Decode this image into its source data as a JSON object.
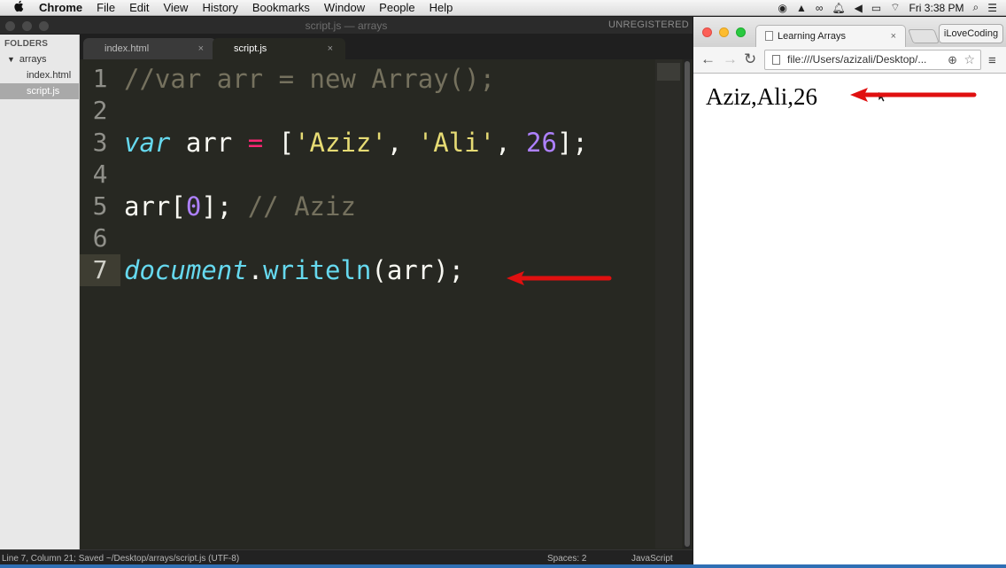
{
  "menubar": {
    "apple": "",
    "app": "Chrome",
    "items": [
      "File",
      "Edit",
      "View",
      "History",
      "Bookmarks",
      "Window",
      "People",
      "Help"
    ],
    "clock": "Fri 3:38 PM"
  },
  "editor": {
    "window_title": "script.js — arrays",
    "unregistered": "UNREGISTERED",
    "sidebar": {
      "header": "FOLDERS",
      "folder": "arrays",
      "files": [
        "index.html",
        "script.js"
      ]
    },
    "tabs": [
      {
        "label": "index.html",
        "close": "×"
      },
      {
        "label": "script.js",
        "close": "×"
      }
    ],
    "line_numbers": [
      "1",
      "2",
      "3",
      "4",
      "5",
      "6",
      "7"
    ],
    "code": {
      "l1_comment": "//var arr = new Array();",
      "l3_kw": "var",
      "l3_name": " arr ",
      "l3_eq": "=",
      "l3_open": " [",
      "l3_s1": "'Aziz'",
      "l3_c1": ", ",
      "l3_s2": "'Ali'",
      "l3_c2": ", ",
      "l3_num": "26",
      "l3_close": "];",
      "l5_a": "arr[",
      "l5_num": "0",
      "l5_b": "]; ",
      "l5_comment": "// Aziz",
      "l7_obj": "document",
      "l7_dot": ".",
      "l7_fn": "writeln",
      "l7_rest": "(arr);"
    },
    "status": {
      "left": "Line 7, Column 21; Saved ~/Desktop/arrays/script.js (UTF-8)",
      "spaces": "Spaces: 2",
      "syntax": "JavaScript"
    }
  },
  "browser": {
    "tab_title": "Learning Arrays",
    "tab_close": "×",
    "profile": "iLoveCoding",
    "url": "file:///Users/azizali/Desktop/...",
    "output": "Aziz,Ali,26"
  },
  "colors": {
    "arrow": "#e01010",
    "editor_bg": "#272822"
  }
}
